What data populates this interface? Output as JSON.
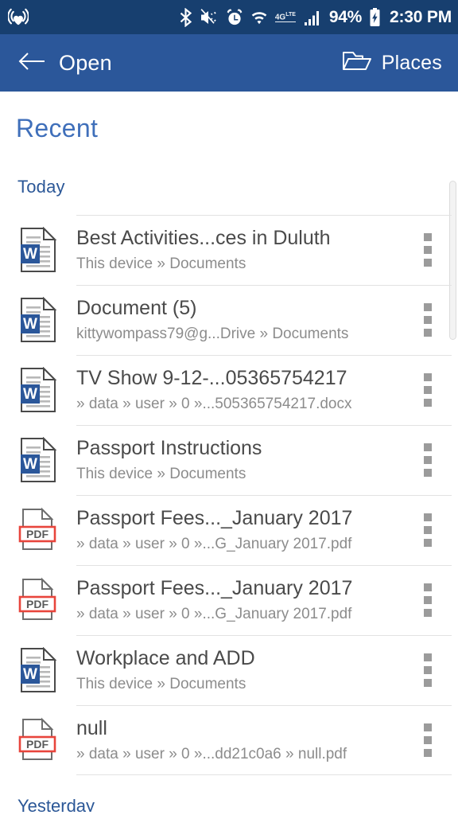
{
  "statusbar": {
    "left_icons": [
      {
        "name": "iheartradio-icon",
        "glyph": "((♥))"
      }
    ],
    "right_icons": [
      {
        "name": "bluetooth-icon"
      },
      {
        "name": "mute-vibrate-icon"
      },
      {
        "name": "alarm-icon"
      },
      {
        "name": "wifi-icon"
      },
      {
        "name": "network-4glte-icon",
        "label": "4G"
      },
      {
        "name": "cellular-signal-icon"
      }
    ],
    "battery_percent": "94%",
    "battery_icon": "battery-charging-icon",
    "time": "2:30 PM"
  },
  "appbar": {
    "back_icon": "back-arrow-icon",
    "title": "Open",
    "places_icon": "folder-open-icon",
    "places_label": "Places"
  },
  "content": {
    "page_title": "Recent",
    "sections": [
      {
        "label": "Today"
      },
      {
        "label": "Yesterday"
      }
    ]
  },
  "files": [
    {
      "type": "word",
      "badge": "W",
      "name": "Best Activities...ces in Duluth",
      "path": "This device » Documents"
    },
    {
      "type": "word",
      "badge": "W",
      "name": "Document (5)",
      "path": "kittywompass79@g...Drive » Documents"
    },
    {
      "type": "word",
      "badge": "W",
      "name": "TV Show 9-12-...05365754217",
      "path": "» data » user » 0 »...505365754217.docx"
    },
    {
      "type": "word",
      "badge": "W",
      "name": "Passport Instructions",
      "path": "This device » Documents"
    },
    {
      "type": "pdf",
      "badge": "PDF",
      "name": "Passport Fees..._January 2017",
      "path": "» data » user » 0 »...G_January 2017.pdf"
    },
    {
      "type": "pdf",
      "badge": "PDF",
      "name": "Passport Fees..._January 2017",
      "path": "» data » user » 0 »...G_January 2017.pdf"
    },
    {
      "type": "word",
      "badge": "W",
      "name": "Workplace and ADD",
      "path": "This device » Documents"
    },
    {
      "type": "pdf",
      "badge": "PDF",
      "name": "null",
      "path": "» data » user » 0 »...dd21c0a6 » null.pdf"
    }
  ],
  "colors": {
    "statusbar_bg": "#173f6f",
    "appbar_bg": "#2b579a",
    "word_blue": "#2b579a",
    "pdf_red": "#e8453c",
    "title_blue": "#3f6fba",
    "section_blue": "#2b5797",
    "filename_gray": "#4a4a4a",
    "path_gray": "#8c8c8c"
  }
}
